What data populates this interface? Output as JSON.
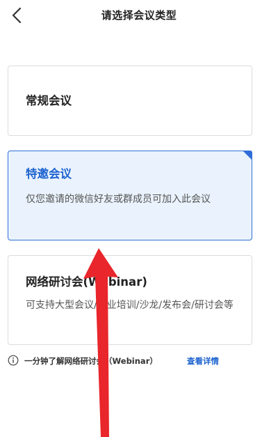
{
  "header": {
    "back_icon": "chevron-left-icon",
    "title": "请选择会议类型"
  },
  "meeting_types": [
    {
      "title": "常规会议",
      "description": "",
      "selected": false
    },
    {
      "title": "特邀会议",
      "description": "仅您邀请的微信好友或群成员可加入此会议",
      "selected": true
    },
    {
      "title": "网络研讨会(Webinar)",
      "description": "可支持大型会议/企业培训/沙龙/发布会/研讨会等",
      "selected": false
    }
  ],
  "info": {
    "icon": "info-circle-icon",
    "text": "一分钟了解网络研讨会（Webinar）",
    "link_label": "查看详情"
  },
  "colors": {
    "accent": "#2f6ed8",
    "selected_bg": "#eaf3fd",
    "annotation_arrow": "#e8262b"
  }
}
